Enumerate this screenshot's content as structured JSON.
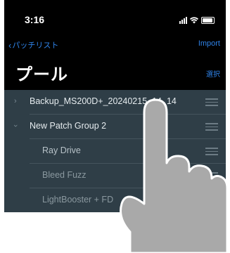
{
  "status_bar": {
    "time": "3:16"
  },
  "nav": {
    "back_label": "パッチリスト",
    "import_label": "Import",
    "title": "プール",
    "select_label": "選択"
  },
  "list": {
    "rows": [
      {
        "label": "Backup_MS200D+_20240215_14_14",
        "expanded": false
      },
      {
        "label": "New Patch Group 2",
        "expanded": true
      },
      {
        "label": "Ray Drive"
      },
      {
        "label": "Bleed Fuzz"
      },
      {
        "label": "LightBooster + FD"
      }
    ]
  },
  "icons": {
    "signal": "cellular-signal-icon",
    "wifi": "wifi-icon",
    "battery": "battery-icon",
    "drag": "drag-handle-icon",
    "hand": "pointing-hand-icon"
  },
  "colors": {
    "accent": "#2f83e8",
    "list_bg": "#2f3e47",
    "header_bg": "#000000"
  }
}
